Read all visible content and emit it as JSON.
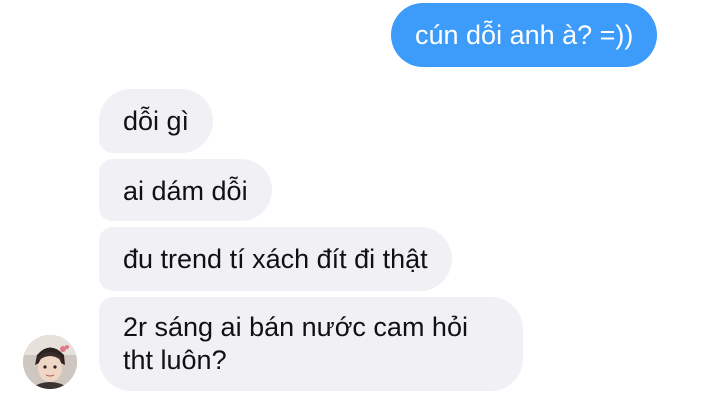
{
  "messages": [
    {
      "direction": "sent",
      "text": "cún dỗi anh à? =))"
    },
    {
      "direction": "received",
      "text": "dỗi gì"
    },
    {
      "direction": "received",
      "text": "ai dám dỗi"
    },
    {
      "direction": "received",
      "text": "đu trend tí xách đít đi thật"
    },
    {
      "direction": "received",
      "text": "2r sáng ai bán nước cam hỏi tht luôn?"
    }
  ],
  "colors": {
    "sent_bubble": "#3d9bf9",
    "received_bubble": "#f1f0f5",
    "background": "#ffffff"
  },
  "icons": {
    "avatar": "user-avatar-photo"
  }
}
